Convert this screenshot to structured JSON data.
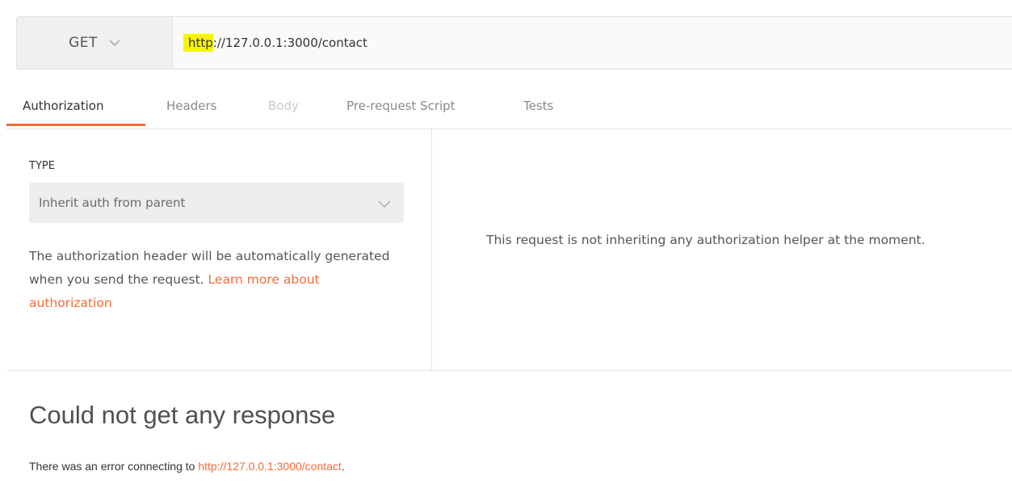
{
  "request": {
    "method": "GET",
    "url_highlight": "http",
    "url_rest": "://127.0.0.1:3000/contact"
  },
  "tabs": [
    {
      "label": "Authorization"
    },
    {
      "label": "Headers"
    },
    {
      "label": "Body"
    },
    {
      "label": "Pre-request Script"
    },
    {
      "label": "Tests"
    }
  ],
  "auth": {
    "type_label": "TYPE",
    "selected_type": "Inherit auth from parent",
    "description": "The authorization header will be automatically generated when you send the request. ",
    "learn_more": "Learn more about authorization",
    "helper_message": "This request is not inheriting any authorization helper at the moment."
  },
  "response": {
    "title": "Could not get any response",
    "error_prefix": "There was an error connecting to ",
    "error_url": "http://127.0.0.1:3000/contact",
    "error_suffix": "."
  },
  "colors": {
    "accent": "#f26b3a",
    "highlight": "#f5f500"
  }
}
